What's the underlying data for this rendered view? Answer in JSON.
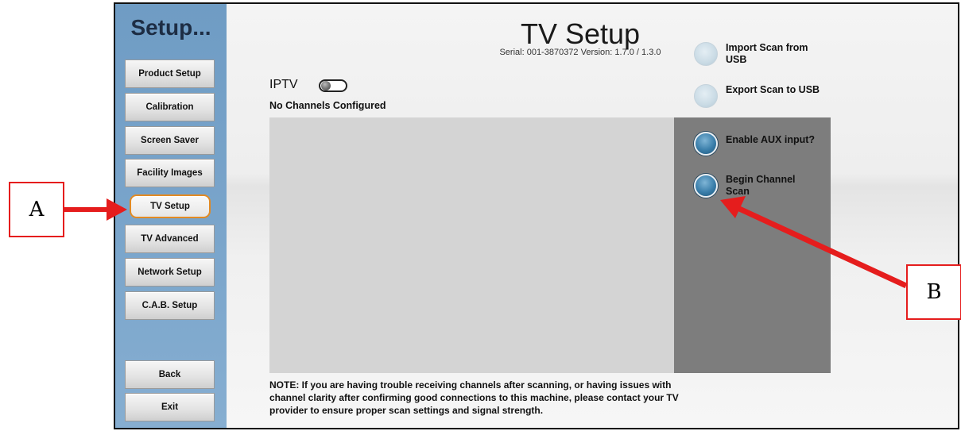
{
  "sidebar": {
    "title": "Setup...",
    "items": [
      {
        "label": "Product Setup"
      },
      {
        "label": "Calibration"
      },
      {
        "label": "Screen Saver"
      },
      {
        "label": "Facility Images"
      },
      {
        "label": "TV Setup",
        "active": true
      },
      {
        "label": "TV Advanced"
      },
      {
        "label": "Network Setup"
      },
      {
        "label": "C.A.B. Setup"
      }
    ],
    "back_label": "Back",
    "exit_label": "Exit"
  },
  "header": {
    "title": "TV Setup",
    "serial": "Serial: 001-3870372  Version: 1.7.0 / 1.3.0"
  },
  "iptv": {
    "label": "IPTV",
    "enabled": false
  },
  "channels": {
    "status": "No Channels Configured"
  },
  "options": {
    "import_scan": "Import Scan from USB",
    "export_scan": "Export Scan to USB",
    "enable_aux": "Enable AUX input?",
    "begin_scan": "Begin Channel Scan"
  },
  "note": "NOTE: If you are having trouble receiving channels after scanning, or having issues with channel clarity after confirming good connections to this machine, please contact your TV provider to ensure proper scan settings and signal strength.",
  "callouts": {
    "a": "A",
    "b": "B"
  },
  "colors": {
    "annotation": "#e51d1d",
    "active_border": "#e28a23",
    "sidebar": "#7aa5cb"
  }
}
